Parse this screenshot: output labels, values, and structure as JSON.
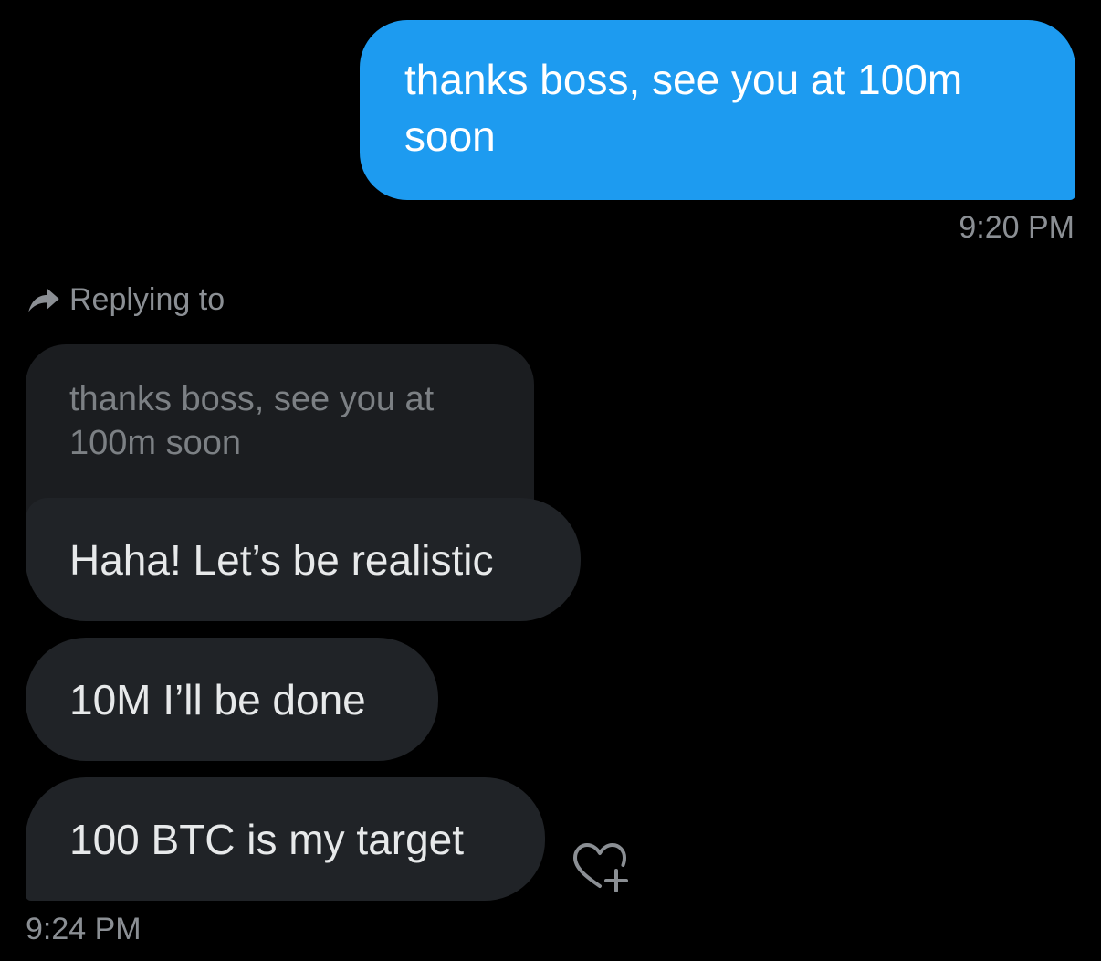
{
  "sent_message": {
    "text": "thanks boss, see you at 100m soon",
    "timestamp": "9:20 PM",
    "bubble_color": "#1d9bf0"
  },
  "reply": {
    "label": "Replying to",
    "icon": "reply-arrow-icon",
    "quoted_text": "thanks boss, see you at 100m soon"
  },
  "received_messages": [
    {
      "text": "Haha! Let’s be realistic"
    },
    {
      "text": "10M I’ll be done"
    },
    {
      "text": "100 BTC is my target"
    }
  ],
  "received_timestamp": "9:24 PM",
  "reaction_button": {
    "icon": "heart-plus-icon"
  },
  "colors": {
    "background": "#000000",
    "received_bubble": "#202327",
    "quoted_bubble": "#1b1d20",
    "muted_text": "#8b8f94"
  }
}
